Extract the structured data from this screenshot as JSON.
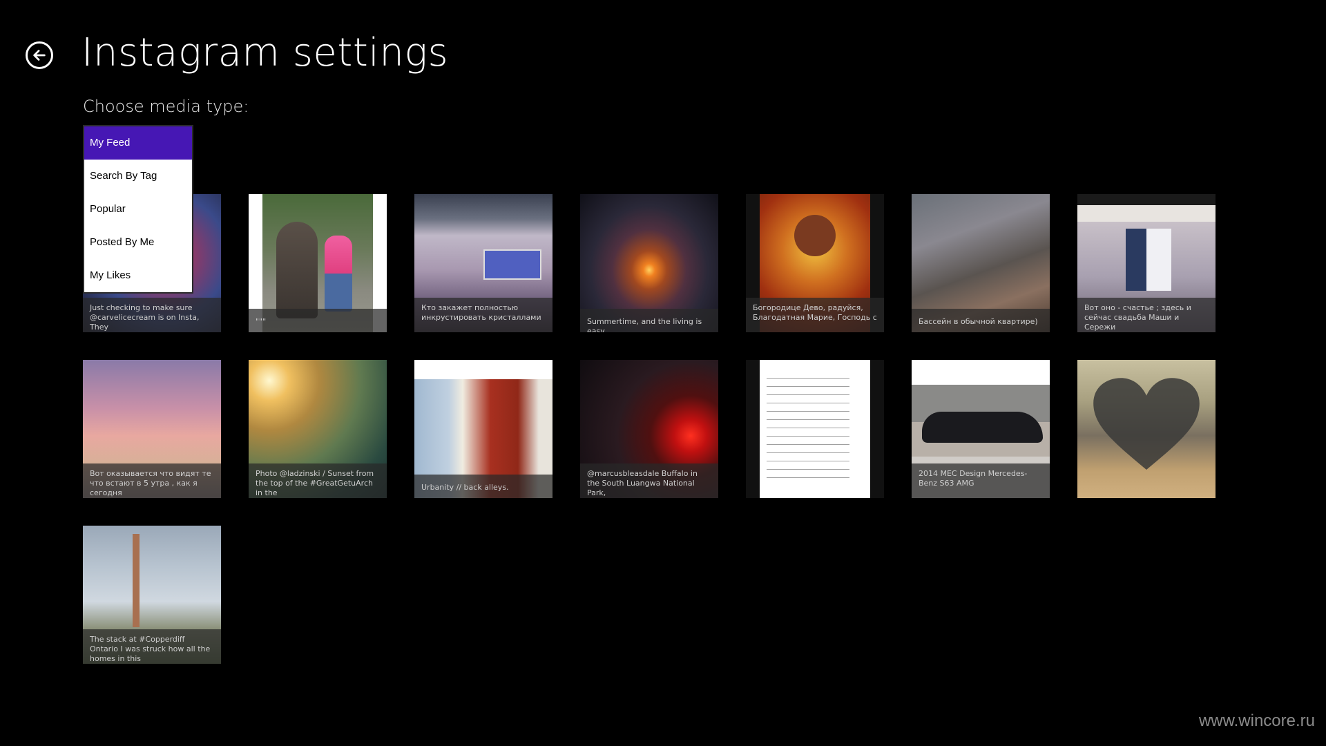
{
  "header": {
    "title": "Instagram settings",
    "subtitle": "Choose media type:"
  },
  "dropdown": {
    "options": [
      "My Feed",
      "Search By Tag",
      "Popular",
      "Posted By Me",
      "My Likes"
    ],
    "selected": "My Feed",
    "accent": "#4617b4"
  },
  "tiles": [
    {
      "caption": "Just checking to make sure @carvelicecream is on Insta, They"
    },
    {
      "caption": "\"\"\""
    },
    {
      "caption": "Кто закажет полностью инкрустировать кристаллами"
    },
    {
      "caption": "Summertime, and the living is easy"
    },
    {
      "caption": "Богородице Дево, радуйся, Благодатная Марие, Господь с"
    },
    {
      "caption": "Бассейн в обычной квартире)"
    },
    {
      "caption": "Вот оно - счастье ; здесь и сейчас свадьба Маши и Сережи"
    },
    {
      "caption": "Вот оказывается что видят те что встают в 5 утра , как я сегодня"
    },
    {
      "caption": "Photo @ladzinski / Sunset from the top of the #GreatGetuArch in the"
    },
    {
      "caption": "Urbanity // back alleys."
    },
    {
      "caption": "@marcusbleasdale Buffalo in the South Luangwa National Park,"
    },
    {
      "caption": ""
    },
    {
      "caption": "2014 MEC Design Mercedes-Benz S63 AMG"
    },
    {
      "caption": ""
    },
    {
      "caption": "The stack at #Copperdiff Ontario I was struck how all the homes in this"
    }
  ],
  "watermark": "www.wincore.ru"
}
